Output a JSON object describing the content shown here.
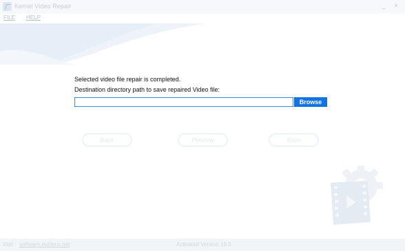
{
  "window": {
    "title": "Kernel Video Repair",
    "minimize_glyph": "_",
    "close_glyph": "×"
  },
  "menu": {
    "items": [
      {
        "label": "FILE"
      },
      {
        "label": "HELP"
      }
    ]
  },
  "main": {
    "status_message": "Selected video file repair is completed.",
    "destination_label": "Destination directory path to save repaired Video file:",
    "path_value": "",
    "browse_label": "Browse"
  },
  "actions": {
    "back_label": "Back",
    "preview_label": "Preview",
    "save_label": "Save"
  },
  "statusbar": {
    "web_label": "Visit :",
    "web_link": "software.nucleus.net",
    "version": "Activated Version 19.0"
  },
  "colors": {
    "accent": "#1273e6",
    "input_border": "#3b8de4",
    "faded_text": "#d1d7de"
  },
  "icons": {
    "app": "app-logo-icon",
    "decoration": "video-gear-icon"
  }
}
